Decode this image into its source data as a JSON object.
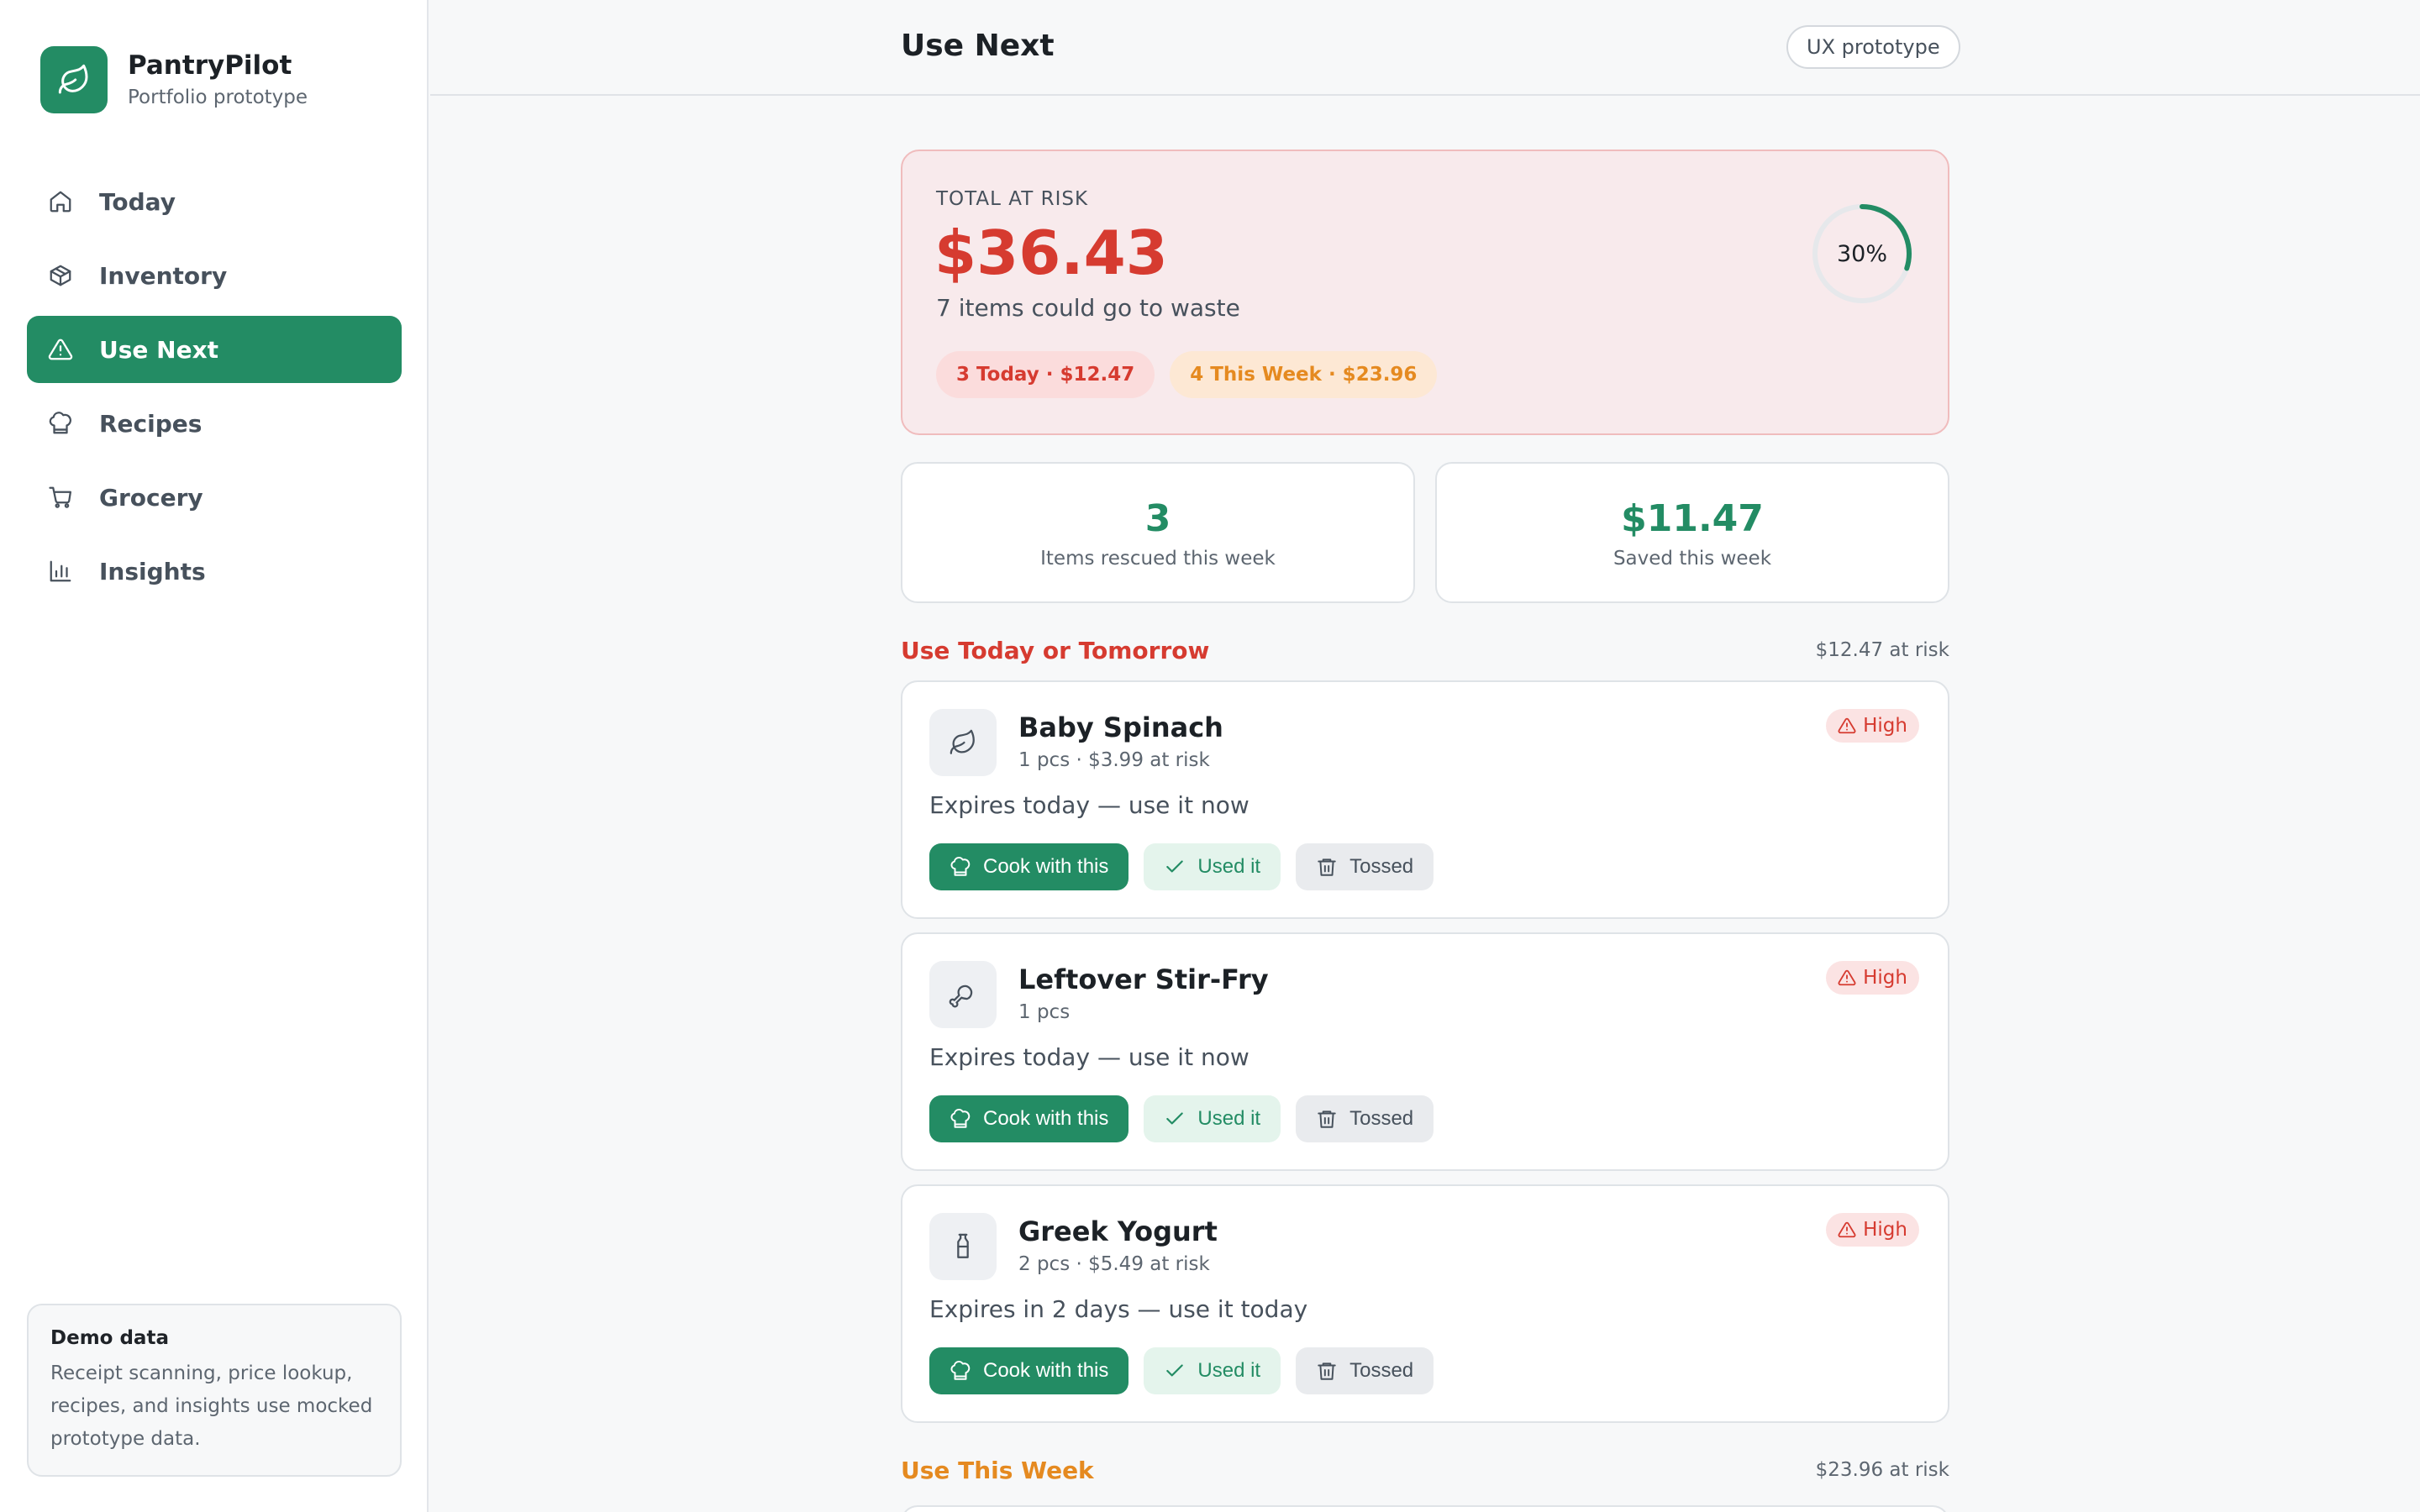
{
  "app": {
    "name": "PantryPilot",
    "subtitle": "Portfolio prototype",
    "brand_color": "#238c64"
  },
  "sidebar": {
    "items": [
      {
        "label": "Today",
        "icon": "home-icon",
        "active": false
      },
      {
        "label": "Inventory",
        "icon": "box-icon",
        "active": false
      },
      {
        "label": "Use Next",
        "icon": "alert-triangle-icon",
        "active": true
      },
      {
        "label": "Recipes",
        "icon": "chef-hat-icon",
        "active": false
      },
      {
        "label": "Grocery",
        "icon": "cart-icon",
        "active": false
      },
      {
        "label": "Insights",
        "icon": "bar-chart-icon",
        "active": false
      }
    ],
    "demo": {
      "title": "Demo data",
      "text": "Receipt scanning, price lookup, recipes, and insights use mocked prototype data."
    }
  },
  "header": {
    "title": "Use Next",
    "badge": "UX prototype"
  },
  "risk": {
    "label": "TOTAL AT RISK",
    "amount": "$36.43",
    "subtitle": "7 items could go to waste",
    "today_pill": "3 Today · $12.47",
    "week_pill": "4 This Week · $23.96",
    "progress_label": "30%",
    "progress_value": 0.3,
    "danger_color": "#d63b30",
    "warning_color": "#e58a20"
  },
  "stats": [
    {
      "value": "3",
      "label": "Items rescued this week"
    },
    {
      "value": "$11.47",
      "label": "Saved this week"
    }
  ],
  "sections": {
    "today": {
      "title": "Use Today or Tomorrow",
      "risk": "$12.47 at risk",
      "items": [
        {
          "name": "Baby Spinach",
          "meta": "1 pcs · $3.99 at risk",
          "expiry": "Expires today — use it now",
          "priority": "High",
          "icon": "leaf-icon"
        },
        {
          "name": "Leftover Stir-Fry",
          "meta": "1 pcs",
          "expiry": "Expires today — use it now",
          "priority": "High",
          "icon": "drumstick-icon"
        },
        {
          "name": "Greek Yogurt",
          "meta": "2 pcs · $5.49 at risk",
          "expiry": "Expires in 2 days — use it today",
          "priority": "High",
          "icon": "bottle-icon"
        }
      ]
    },
    "week": {
      "title": "Use This Week",
      "risk": "$23.96 at risk"
    }
  },
  "actions": {
    "cook": "Cook with this",
    "used": "Used it",
    "tossed": "Tossed"
  }
}
